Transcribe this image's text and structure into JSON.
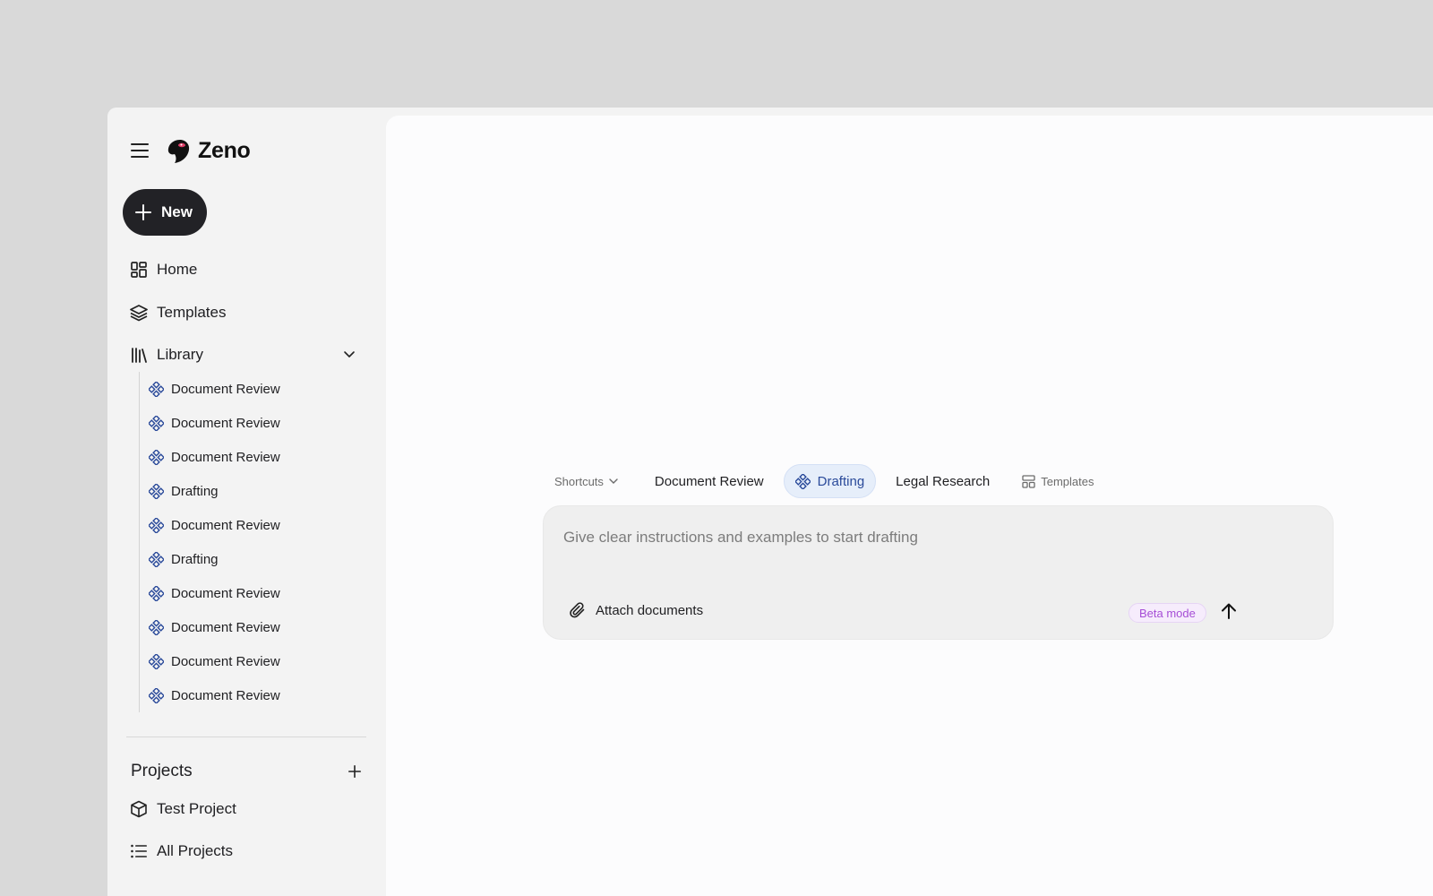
{
  "app": {
    "name": "Zeno"
  },
  "sidebar": {
    "new_label": "New",
    "nav": [
      {
        "label": "Home",
        "icon": "grid-icon"
      },
      {
        "label": "Templates",
        "icon": "layers-icon"
      },
      {
        "label": "Library",
        "icon": "books-icon",
        "expanded": true
      }
    ],
    "library_items": [
      {
        "label": "Document Review",
        "icon": "workflow-icon"
      },
      {
        "label": "Document Review",
        "icon": "workflow-icon"
      },
      {
        "label": "Document Review",
        "icon": "workflow-icon"
      },
      {
        "label": "Drafting",
        "icon": "workflow-icon"
      },
      {
        "label": "Document Review",
        "icon": "workflow-icon"
      },
      {
        "label": "Drafting",
        "icon": "workflow-icon"
      },
      {
        "label": "Document Review",
        "icon": "workflow-icon"
      },
      {
        "label": "Document Review",
        "icon": "workflow-icon"
      },
      {
        "label": "Document Review",
        "icon": "workflow-icon"
      },
      {
        "label": "Document Review",
        "icon": "workflow-icon"
      }
    ],
    "projects": {
      "title": "Projects",
      "items": [
        {
          "label": "Test Project",
          "icon": "box-icon"
        },
        {
          "label": "All Projects",
          "icon": "list-icon"
        }
      ]
    }
  },
  "composer": {
    "shortcuts_label": "Shortcuts",
    "tabs": [
      {
        "label": "Document Review",
        "active": false
      },
      {
        "label": "Drafting",
        "active": true
      },
      {
        "label": "Legal Research",
        "active": false
      }
    ],
    "templates_label": "Templates",
    "placeholder": "Give clear instructions and examples to start drafting",
    "attach_label": "Attach documents",
    "beta_label": "Beta mode"
  },
  "colors": {
    "accent": "#2a4a9a",
    "beta": "#a64ed6",
    "new_button": "#222226"
  }
}
